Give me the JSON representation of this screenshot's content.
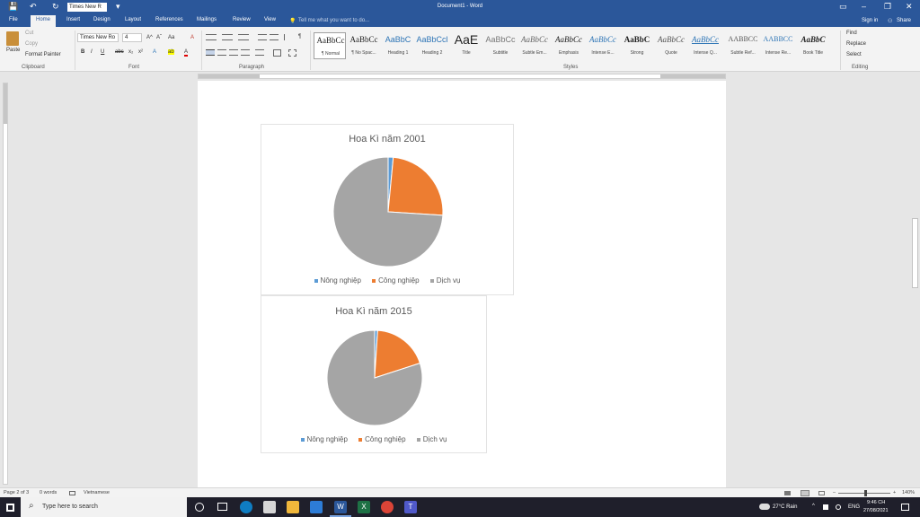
{
  "app": {
    "window_title": "Document1 - Word",
    "font_name": "Times New R",
    "sign_in": "Sign in",
    "share": "Share"
  },
  "icons": {
    "save": "💾",
    "undo": "↶",
    "redo": "↻",
    "customize": "▾",
    "ribbon_display": "▭",
    "minimize": "–",
    "restore": "❐",
    "close": "✕",
    "share": "⚇",
    "tellme": "💡",
    "search": "⌕"
  },
  "tabs": [
    "File",
    "Home",
    "Insert",
    "Design",
    "Layout",
    "References",
    "Mailings",
    "Review",
    "View"
  ],
  "tell_me": "Tell me what you want to do...",
  "ribbon": {
    "clipboard": {
      "paste": "Paste",
      "cut": "Cut",
      "copy": "Copy",
      "format_painter": "Format Painter",
      "label": "Clipboard"
    },
    "font": {
      "name": "Times New Ro",
      "size": "4",
      "bold": "B",
      "italic": "I",
      "underline": "U",
      "strike": "abc",
      "sub": "x₂",
      "sup": "x²",
      "grow": "A^",
      "shrink": "Aˇ",
      "case": "Aa",
      "clear": "A",
      "effects": "A",
      "highlight": "ab",
      "color": "A",
      "label": "Font"
    },
    "paragraph": {
      "label": "Paragraph",
      "pilcrow": "¶"
    },
    "styles": {
      "label": "Styles",
      "items": [
        {
          "preview": "AaBbCc",
          "name": "¶ Normal"
        },
        {
          "preview": "AaBbCc",
          "name": "¶ No Spac..."
        },
        {
          "preview": "AaBbC",
          "name": "Heading 1"
        },
        {
          "preview": "AaBbCcl",
          "name": "Heading 2"
        },
        {
          "preview": "AaE",
          "name": "Title"
        },
        {
          "preview": "AaBbCc",
          "name": "Subtitle"
        },
        {
          "preview": "AaBbCc",
          "name": "Subtle Em..."
        },
        {
          "preview": "AaBbCc",
          "name": "Emphasis"
        },
        {
          "preview": "AaBbCc",
          "name": "Intense E..."
        },
        {
          "preview": "AaBbC",
          "name": "Strong"
        },
        {
          "preview": "AaBbCc",
          "name": "Quote"
        },
        {
          "preview": "AaBbCc",
          "name": "Intense Q..."
        },
        {
          "preview": "AABBCC",
          "name": "Subtle Ref..."
        },
        {
          "preview": "AABBCC",
          "name": "Intense Re..."
        },
        {
          "preview": "AaBbC",
          "name": "Book Title"
        }
      ]
    },
    "editing": {
      "find": "Find",
      "replace": "Replace",
      "select": "Select",
      "label": "Editing"
    }
  },
  "charts": [
    {
      "title": "Hoa Kì năm 2001",
      "slices": [
        {
          "label": "Nông nghiệp",
          "value": 1.5,
          "color": "#5b9bd5"
        },
        {
          "label": "Công nghiệp",
          "value": 24.5,
          "color": "#ed7d31"
        },
        {
          "label": "Dịch vụ",
          "value": 74,
          "color": "#a5a5a5"
        }
      ]
    },
    {
      "title": "Hoa Kì năm 2015",
      "slices": [
        {
          "label": "Nông nghiệp",
          "value": 1,
          "color": "#5b9bd5"
        },
        {
          "label": "Công nghiệp",
          "value": 19,
          "color": "#ed7d31"
        },
        {
          "label": "Dịch vụ",
          "value": 80,
          "color": "#a5a5a5"
        }
      ]
    }
  ],
  "chart_data": [
    {
      "type": "pie",
      "title": "Hoa Kì năm 2001",
      "categories": [
        "Nông nghiệp",
        "Công nghiệp",
        "Dịch vụ"
      ],
      "values": [
        1.5,
        24.5,
        74
      ],
      "legend": "bottom"
    },
    {
      "type": "pie",
      "title": "Hoa Kì năm 2015",
      "categories": [
        "Nông nghiệp",
        "Công nghiệp",
        "Dịch vụ"
      ],
      "values": [
        1,
        19,
        80
      ],
      "legend": "bottom"
    }
  ],
  "status": {
    "page": "Page 2 of 3",
    "words": "0 words",
    "language": "Vietnamese",
    "zoom": "140%"
  },
  "taskbar": {
    "search_placeholder": "Type here to search",
    "weather": "27°C Rain",
    "lang": "ENG",
    "time": "9:46 CH",
    "date": "27/08/2021"
  }
}
